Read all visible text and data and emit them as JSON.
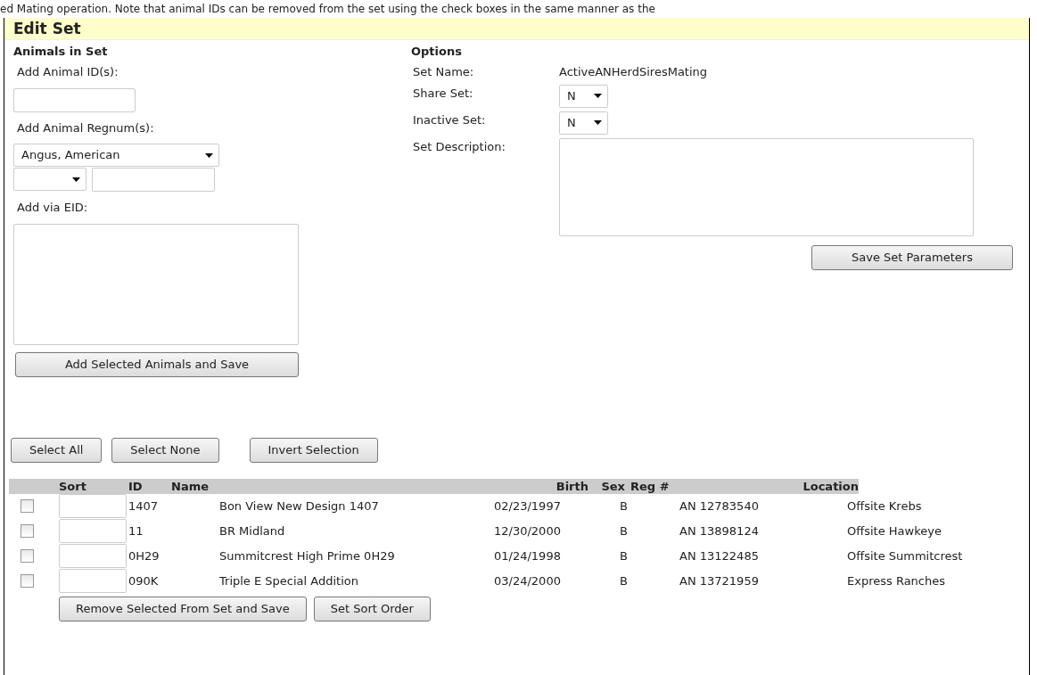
{
  "intro_text": "ed Mating operation. Note that animal IDs can be removed from the set using the check boxes in the same manner as the",
  "panel": {
    "title": "Edit Set"
  },
  "animals_in_set": {
    "heading": "Animals in Set",
    "id_label": "Add Animal ID(s):",
    "regnum_label": "Add Animal Regnum(s):",
    "breed_select": "Angus, American",
    "eid_label": "Add via EID:",
    "add_button": "Add Selected Animals and Save"
  },
  "options": {
    "heading": "Options",
    "fields": [
      {
        "kind": "text",
        "label": "Set Name:",
        "value": "ActiveANHerdSiresMating"
      },
      {
        "kind": "select",
        "label": "Share Set:",
        "value": "N"
      },
      {
        "kind": "select",
        "label": "Inactive Set:",
        "value": "N"
      },
      {
        "kind": "textarea",
        "label": "Set Description:"
      }
    ],
    "save_button": "Save Set Parameters"
  },
  "selection_buttons": [
    "Select All",
    "Select None",
    "Invert Selection"
  ],
  "table": {
    "columns": [
      "Sort",
      "ID",
      "Name",
      "Birth",
      "Sex",
      "Reg #",
      "Location"
    ],
    "rows": [
      {
        "checked": false,
        "id": "1407",
        "name": "Bon View New Design 1407",
        "birth": "02/23/1997",
        "sex": "B",
        "reg": "AN 12783540",
        "location": "Offsite Krebs"
      },
      {
        "checked": false,
        "id": "11",
        "name": "BR Midland",
        "birth": "12/30/2000",
        "sex": "B",
        "reg": "AN 13898124",
        "location": "Offsite Hawkeye"
      },
      {
        "checked": false,
        "id": "0H29",
        "name": "Summitcrest High Prime 0H29",
        "birth": "01/24/1998",
        "sex": "B",
        "reg": "AN 13122485",
        "location": "Offsite Summitcrest"
      },
      {
        "checked": false,
        "id": "090K",
        "name": "Triple E Special Addition",
        "birth": "03/24/2000",
        "sex": "B",
        "reg": "AN 13721959",
        "location": "Express Ranches"
      }
    ]
  },
  "bottom_buttons": [
    "Remove Selected From Set and Save",
    "Set Sort Order"
  ]
}
